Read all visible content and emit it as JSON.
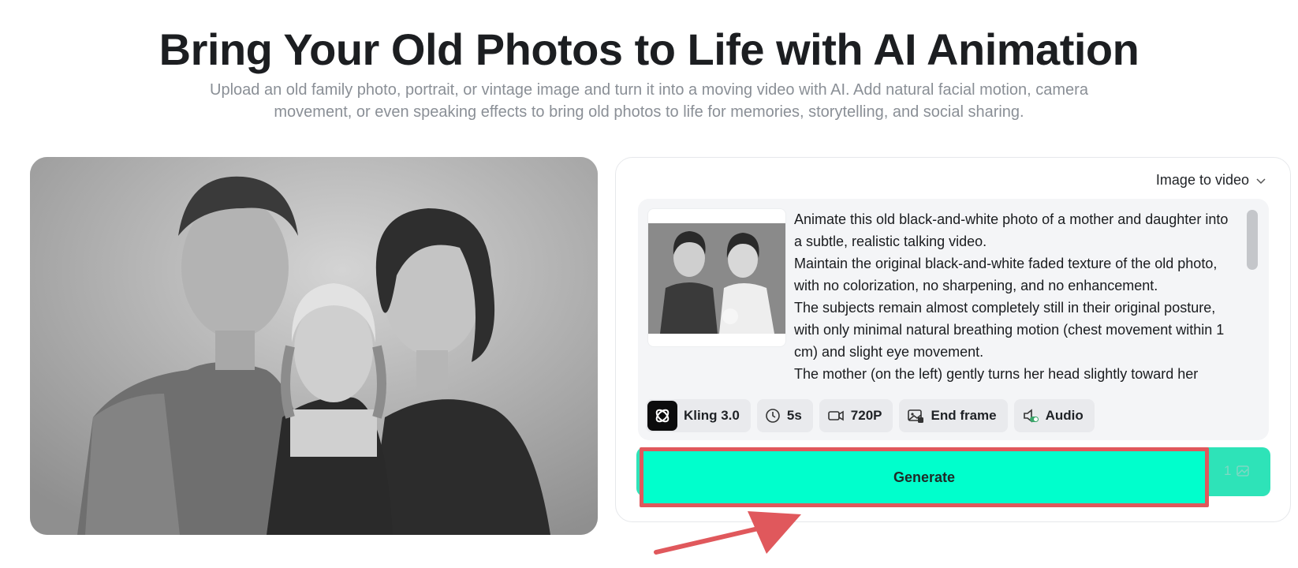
{
  "hero": {
    "title": "Bring Your Old Photos to Life with AI Animation",
    "subtitle": "Upload an old family photo, portrait, or vintage image and turn it into a moving video with AI. Add natural facial motion, camera movement, or even speaking effects to bring old photos to life for memories, storytelling, and social sharing."
  },
  "panel": {
    "mode_label": "Image to video",
    "prompt_paragraphs": [
      "Animate this old black-and-white photo of a mother and daughter into a subtle, realistic talking video.",
      "Maintain the original black-and-white faded texture of the old photo, with no colorization, no sharpening, and no enhancement.",
      "The subjects remain almost completely still in their original posture, with only minimal natural breathing motion (chest movement within 1 cm) and slight eye movement.",
      "The mother (on the left) gently turns her head slightly toward her"
    ],
    "chips": {
      "model": "Kling 3.0",
      "duration": "5s",
      "resolution": "720P",
      "end_frame": "End frame",
      "audio": "Audio"
    },
    "generate_label": "Generate",
    "credit_count": "1"
  },
  "colors": {
    "generate_bg": "#00ffcc",
    "highlight_border": "#e0585c",
    "arrow": "#e0585c"
  },
  "icons": {
    "mode_chevron": "chevron-down-icon",
    "duration": "clock-icon",
    "resolution": "video-camera-icon",
    "end_frame": "image-frame-icon",
    "audio": "audio-toggle-icon",
    "credit": "credit-icon"
  }
}
